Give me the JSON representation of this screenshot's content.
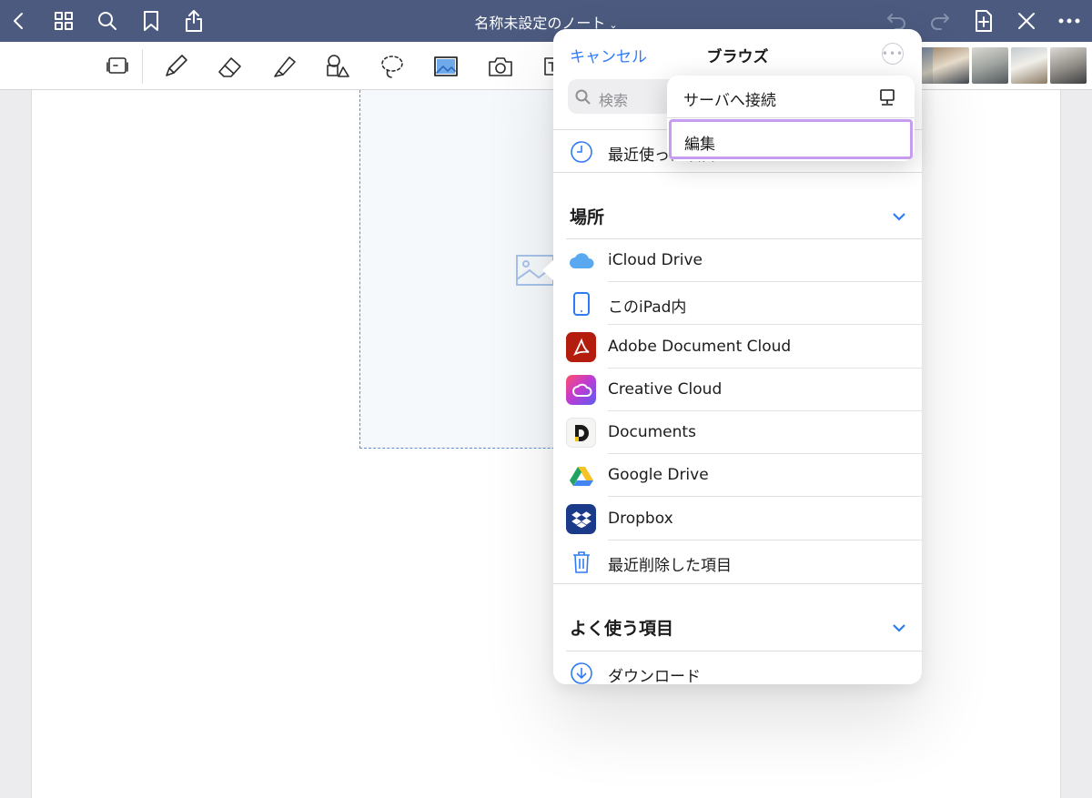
{
  "header": {
    "title": "名称未設定のノート",
    "title_chevron": "⌄"
  },
  "toolbar": {
    "tools": [
      "document-scan-icon",
      "pen-icon",
      "eraser-icon",
      "highlighter-icon",
      "shapes-icon",
      "lasso-icon",
      "image-icon",
      "camera-icon",
      "text-icon"
    ]
  },
  "browse": {
    "cancel": "キャンセル",
    "title": "ブラウズ",
    "more": "•••",
    "search_placeholder": "検索",
    "recent": "最近使った項目",
    "locations_header": "場所",
    "locations": [
      {
        "label": "iCloud Drive",
        "icon": "icloud-icon"
      },
      {
        "label": "このiPad内",
        "icon": "ipad-icon"
      },
      {
        "label": "Adobe Document Cloud",
        "icon": "adobe-acrobat-icon"
      },
      {
        "label": "Creative Cloud",
        "icon": "creative-cloud-icon"
      },
      {
        "label": "Documents",
        "icon": "documents-app-icon"
      },
      {
        "label": "Google Drive",
        "icon": "google-drive-icon"
      },
      {
        "label": "Dropbox",
        "icon": "dropbox-icon"
      },
      {
        "label": "最近削除した項目",
        "icon": "trash-icon"
      }
    ],
    "favorites_header": "よく使う項目",
    "favorites": [
      {
        "label": "ダウンロード",
        "icon": "download-icon"
      }
    ]
  },
  "context_menu": {
    "connect_server": "サーバへ接続",
    "edit": "編集"
  },
  "colors": {
    "topbar": "#4b5a7e",
    "accent_blue": "#2f7bf5",
    "highlight_purple": "#c69cf0"
  }
}
